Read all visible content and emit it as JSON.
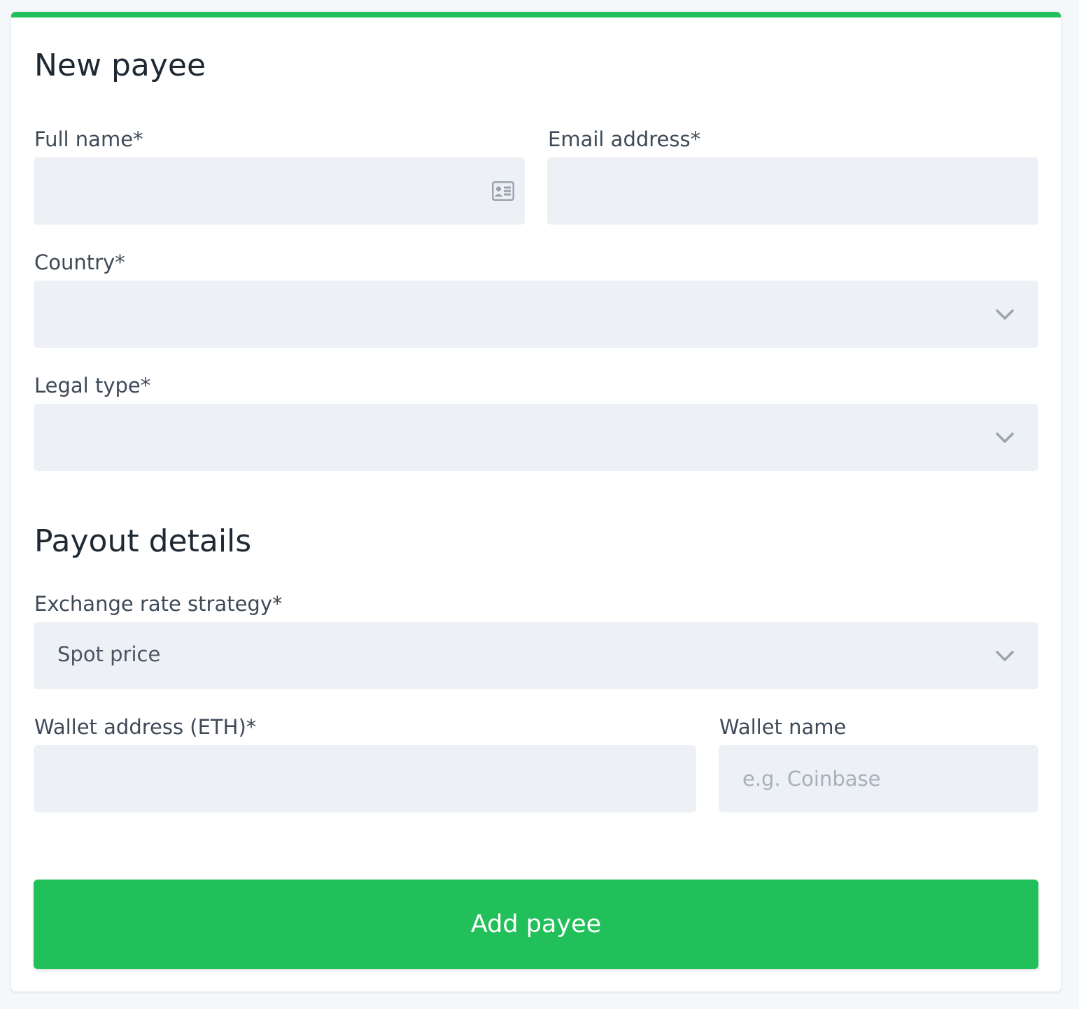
{
  "header": {
    "title": "New payee"
  },
  "colors": {
    "accent": "#22c05a",
    "field_background": "#edf1f5"
  },
  "fields": {
    "full_name": {
      "label": "Full name*",
      "value": "",
      "placeholder": "",
      "icon": "contact-card-icon"
    },
    "email": {
      "label": "Email address*",
      "value": "",
      "placeholder": ""
    },
    "country": {
      "label": "Country*",
      "value": "",
      "icon": "chevron-down-icon"
    },
    "legal_type": {
      "label": "Legal type*",
      "value": "",
      "icon": "chevron-down-icon"
    }
  },
  "payout": {
    "title": "Payout details",
    "exchange_rate": {
      "label": "Exchange rate strategy*",
      "value": "Spot price",
      "icon": "chevron-down-icon"
    },
    "wallet_address": {
      "label": "Wallet address (ETH)*",
      "value": "",
      "placeholder": ""
    },
    "wallet_name": {
      "label": "Wallet name",
      "value": "",
      "placeholder": "e.g. Coinbase"
    }
  },
  "actions": {
    "submit_label": "Add payee"
  }
}
